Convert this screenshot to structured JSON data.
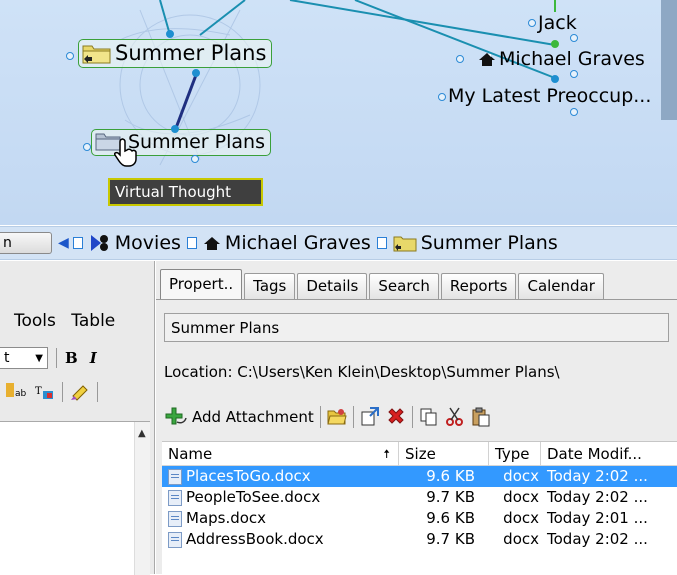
{
  "plex": {
    "nodes": {
      "active_thought": "Summer Plans",
      "virtual_thought": "Summer Plans",
      "jack": "Jack",
      "michael_graves": "Michael Graves",
      "latest_preoccupation": "My Latest Preoccup..."
    },
    "tooltip": "Virtual Thought"
  },
  "past_thoughts": {
    "left_button": "n",
    "items": [
      {
        "label": "Movies",
        "icon": "movie-projector-icon"
      },
      {
        "label": "Michael Graves",
        "icon": "house-icon"
      },
      {
        "label": "Summer Plans",
        "icon": "folder-icon"
      }
    ]
  },
  "left_pane": {
    "menu": [
      "Tools",
      "Table"
    ],
    "format": {
      "dropdown_value": "t",
      "bold": "B",
      "italic": "I"
    }
  },
  "right_pane": {
    "tabs": [
      "Propert..",
      "Tags",
      "Details",
      "Search",
      "Reports",
      "Calendar"
    ],
    "active_tab": "Propert..",
    "name_field": "Summer Plans",
    "location": "Location: C:\\Users\\Ken Klein\\Desktop\\Summer Plans\\",
    "toolbar": {
      "add_attachment": "Add Attachment",
      "icons": [
        "open-folder-icon",
        "new-window-icon",
        "delete-icon",
        "copy-icon",
        "cut-icon",
        "paste-icon"
      ]
    },
    "table": {
      "columns": [
        "Name",
        "Size",
        "Type",
        "Date Modif..."
      ],
      "rows": [
        {
          "name": "PlacesToGo.docx",
          "size": "9.6 KB",
          "type": "docx",
          "date": "Today 2:02 ...",
          "selected": true
        },
        {
          "name": "PeopleToSee.docx",
          "size": "9.7 KB",
          "type": "docx",
          "date": "Today 2:02 ...",
          "selected": false
        },
        {
          "name": "Maps.docx",
          "size": "9.6 KB",
          "type": "docx",
          "date": "Today 2:01 ...",
          "selected": false
        },
        {
          "name": "AddressBook.docx",
          "size": "9.7 KB",
          "type": "docx",
          "date": "Today 2:02 ...",
          "selected": false
        }
      ]
    }
  },
  "colors": {
    "plex_bg": "#c9ddf4",
    "node_border": "#3aa03a",
    "link_line": "#1a8fb0",
    "parent_link": "#1f2f80",
    "selection": "#3399ff"
  }
}
